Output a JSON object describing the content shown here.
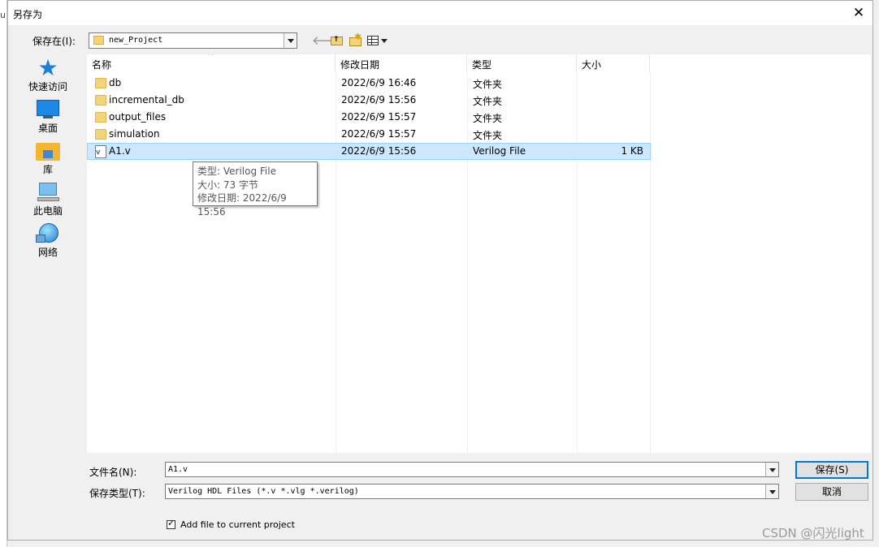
{
  "window": {
    "edge_char": "u",
    "title": "另存为",
    "close_glyph": "✕"
  },
  "toolbar": {
    "save_in_label": "保存在(I):",
    "save_in_value": "new_Project",
    "back_glyph": "🡐",
    "up_glyph": "↑",
    "new_glyph": "✱"
  },
  "places": [
    {
      "label": "快速访问",
      "icon": "star-icon"
    },
    {
      "label": "桌面",
      "icon": "desktop-icon"
    },
    {
      "label": "库",
      "icon": "library-icon"
    },
    {
      "label": "此电脑",
      "icon": "computer-icon"
    },
    {
      "label": "网络",
      "icon": "network-icon"
    }
  ],
  "columns": {
    "name": "名称",
    "date": "修改日期",
    "type": "类型",
    "size": "大小",
    "sort_glyph": "^"
  },
  "files": [
    {
      "name": "db",
      "date": "2022/6/9 16:46",
      "type": "文件夹",
      "size": ""
    },
    {
      "name": "incremental_db",
      "date": "2022/6/9 15:56",
      "type": "文件夹",
      "size": ""
    },
    {
      "name": "output_files",
      "date": "2022/6/9 15:57",
      "type": "文件夹",
      "size": ""
    },
    {
      "name": "simulation",
      "date": "2022/6/9 15:57",
      "type": "文件夹",
      "size": ""
    },
    {
      "name": "A1.v",
      "date": "2022/6/9 15:56",
      "type": "Verilog File",
      "size": "1 KB",
      "file_icon_text": "V"
    }
  ],
  "tooltip": {
    "line1": "类型: Verilog File",
    "line2": "大小: 73 字节",
    "line3": "修改日期: 2022/6/9 15:56"
  },
  "form": {
    "filename_label": "文件名(N):",
    "filename_value": "A1.v",
    "filetype_label": "保存类型(T):",
    "filetype_value": "Verilog HDL Files (*.v *.vlg *.verilog)",
    "save_button": "保存(S)",
    "cancel_button": "取消",
    "checkbox_label": "Add file to current project",
    "checkbox_checked": true
  },
  "watermark": "CSDN @闪光light",
  "colors": {
    "selection_bg": "#cce8ff",
    "selection_border": "#99d1ff",
    "accent": "#0078d7",
    "folder": "#f4d47a"
  }
}
